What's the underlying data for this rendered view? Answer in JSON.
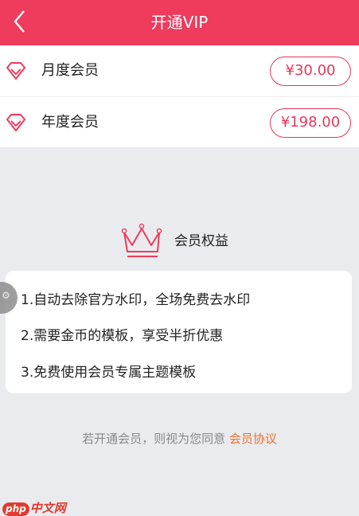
{
  "header": {
    "title": "开通VIP",
    "back_icon": "chevron-left-icon"
  },
  "plans": [
    {
      "label": "月度会员",
      "price": "¥30.00",
      "icon": "diamond-icon"
    },
    {
      "label": "年度会员",
      "price": "¥198.00",
      "icon": "diamond-icon"
    }
  ],
  "benefits": {
    "title": "会员权益",
    "icon": "crown-icon",
    "items": [
      "1.自动去除官方水印，全场免费去水印",
      "2.需要金币的模板，享受半折优惠",
      "3.免费使用会员专属主题模板"
    ]
  },
  "agreement": {
    "text": "若开通会员，则视为您同意 ",
    "link": "会员协议"
  },
  "watermark": {
    "logo": "php",
    "text": "中文网"
  },
  "colors": {
    "accent": "#ef3b5c",
    "price": "#e8365a",
    "link": "#f0702c"
  }
}
